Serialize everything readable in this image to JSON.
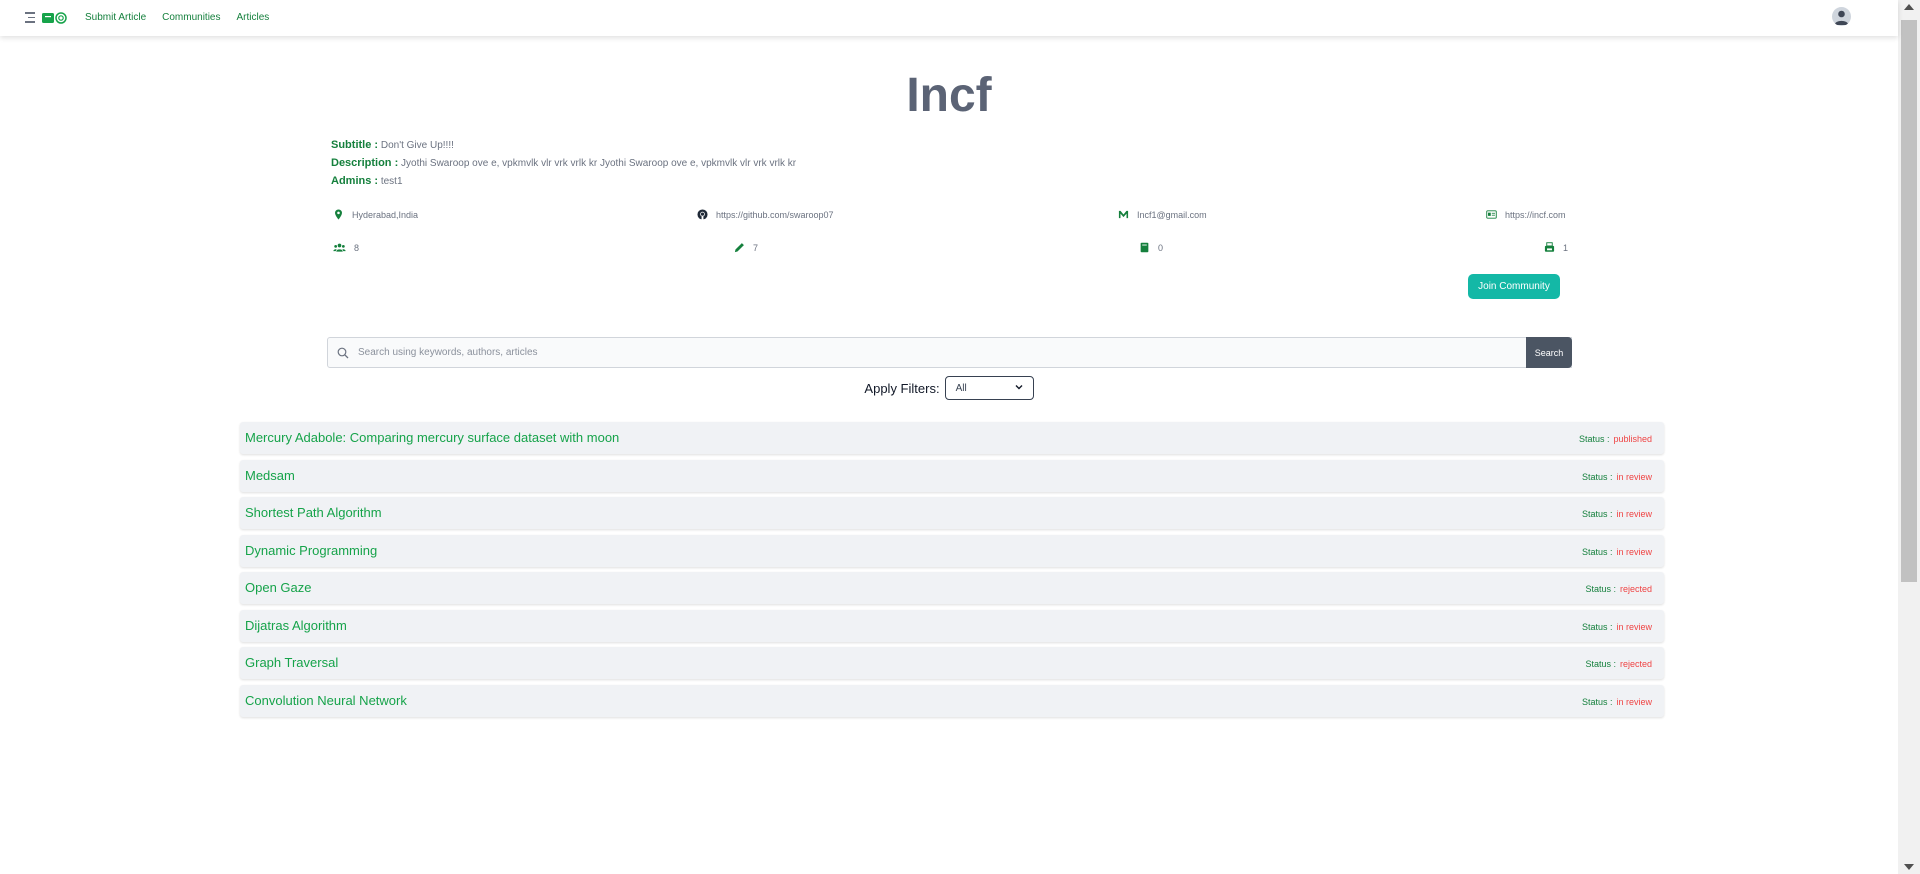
{
  "nav": {
    "links": [
      "Submit Article",
      "Communities",
      "Articles"
    ]
  },
  "community": {
    "name": "Incf",
    "subtitle_label": "Subtitle :",
    "subtitle": "Don't Give Up!!!!",
    "description_label": "Description :",
    "description": "Jyothi Swaroop ove e, vpkmvlk vlr vrk vrlk kr Jyothi Swaroop ove e, vpkmvlk vlr vrk vrlk kr",
    "admins_label": "Admins :",
    "admins": "test1",
    "location": "Hyderabad,India",
    "github": "https://github.com/swaroop07",
    "email": "Incf1@gmail.com",
    "website": "https://incf.com",
    "members_count": "8",
    "authors_count": "7",
    "articles_count": "0",
    "published_count": "1",
    "join_label": "Join Community"
  },
  "search": {
    "placeholder": "Search using keywords, authors, articles",
    "button_label": "Search"
  },
  "filters": {
    "label": "Apply Filters:",
    "selected": "All"
  },
  "articles": [
    {
      "title": "Mercury Adabole: Comparing mercury surface dataset with moon",
      "status_label": "Status :",
      "status": "published"
    },
    {
      "title": "Medsam",
      "status_label": "Status :",
      "status": "in review"
    },
    {
      "title": "Shortest Path Algorithm",
      "status_label": "Status :",
      "status": "in review"
    },
    {
      "title": "Dynamic Programming",
      "status_label": "Status :",
      "status": "in review"
    },
    {
      "title": "Open Gaze",
      "status_label": "Status :",
      "status": "rejected"
    },
    {
      "title": "Dijatras Algorithm",
      "status_label": "Status :",
      "status": "in review"
    },
    {
      "title": "Graph Traversal",
      "status_label": "Status :",
      "status": "rejected"
    },
    {
      "title": "Convolution Neural Network",
      "status_label": "Status :",
      "status": "in review"
    }
  ],
  "colors": {
    "accent_green": "#15803d",
    "join_teal": "#14b8a6",
    "status_red": "#ef4444",
    "search_button": "#4b5563"
  },
  "icons": {
    "menu": "menu-icon",
    "logo": "logo-icon",
    "location": "map-pin-icon",
    "github": "github-icon",
    "email": "mail-icon",
    "website": "id-card-icon",
    "members": "users-icon",
    "authors": "pencil-icon",
    "articles": "book-icon",
    "published": "printer-icon",
    "search": "search-icon",
    "dropdown": "chevron-down-icon"
  }
}
